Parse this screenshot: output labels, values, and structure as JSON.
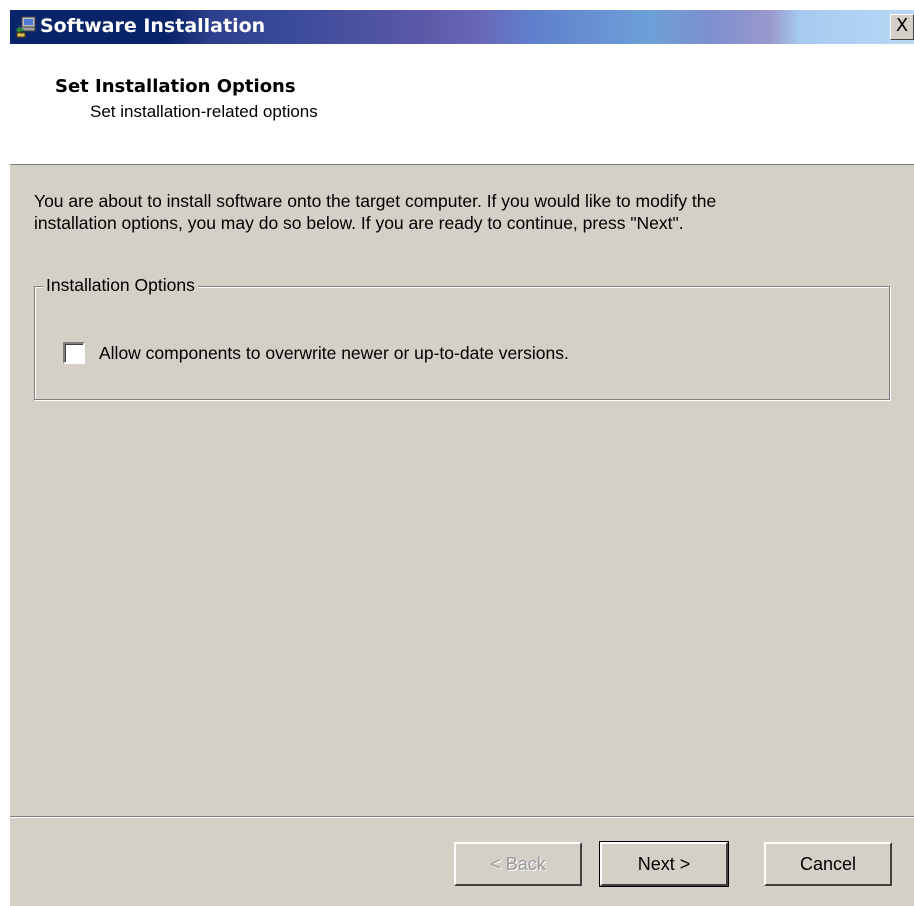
{
  "window": {
    "title": "Software Installation",
    "close_label": "X"
  },
  "header": {
    "title": "Set Installation Options",
    "subtitle": "Set installation-related options"
  },
  "main": {
    "intro_line1": "You are about to install software onto the target computer.  If you would like to modify the",
    "intro_line2": "installation options, you may do so below.  If you are ready to continue, press \"Next\".",
    "options_group_label": "Installation Options",
    "overwrite_checkbox_label": "Allow components to overwrite newer or up-to-date versions.",
    "overwrite_checked": false
  },
  "buttons": {
    "back_label": "< Back",
    "next_label": "Next >",
    "cancel_label": "Cancel"
  },
  "colors": {
    "titlebar_start": "#0a246a",
    "dialog_face": "#d4d0c8",
    "header_background": "#ffffff"
  },
  "icons": {
    "title_icon": "software-install-icon",
    "close_icon": "close-icon",
    "checkbox": "unchecked"
  }
}
